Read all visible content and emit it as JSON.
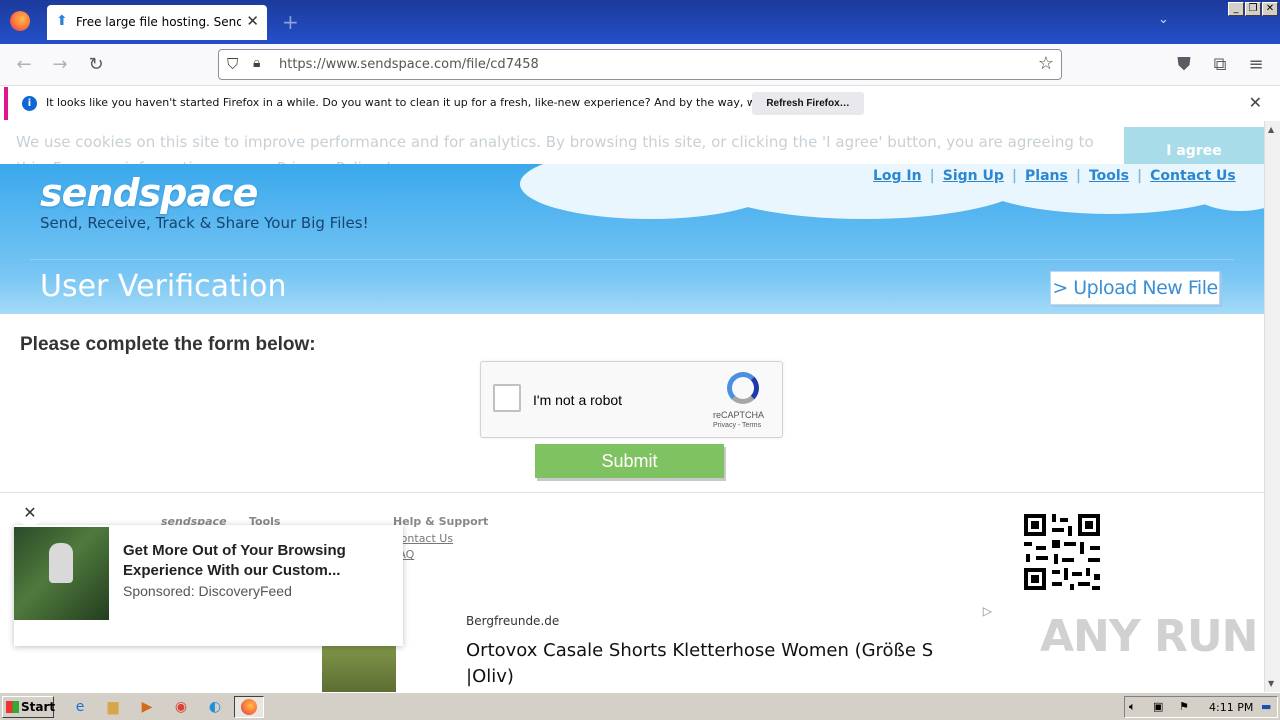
{
  "browser": {
    "tab_title": "Free large file hosting. Send big file",
    "url": "https://www.sendspace.com/file/cd7458",
    "notification": "It looks like you haven't started Firefox in a while. Do you want to clean it up for a fresh, like-new experience? And by the way, welcome back!",
    "refresh_label": "Refresh Firefox…"
  },
  "cookie": {
    "text": "We use cookies on this site to improve performance and for analytics. By browsing this site, or clicking the 'I agree' button, you are agreeing to this. For more information see our Privacy Policy.  Learn more",
    "agree_label": "I agree"
  },
  "header": {
    "logo": "sendspace",
    "tagline": "Send, Receive, Track & Share Your Big Files!",
    "links": [
      "Log In",
      "Sign Up",
      "Plans",
      "Tools",
      "Contact Us"
    ],
    "section_title": "User Verification",
    "upload_label": "> Upload New File"
  },
  "form": {
    "heading": "Please complete the form below:",
    "captcha_label": "I'm not a robot",
    "captcha_brand": "reCAPTCHA",
    "captcha_links": "Privacy - Terms",
    "submit_label": "Submit"
  },
  "footer": {
    "col1": "sendspace",
    "col2": "Tools",
    "col3": "Help & Support",
    "contact": "Contact Us",
    "faq": "FAQ"
  },
  "ads": {
    "ad1_headline": "Get More Out of Your Browsing Experience With our Custom...",
    "ad1_sponsor": "Sponsored: DiscoveryFeed",
    "ad2_source": "Bergfreunde.de",
    "ad2_title": "Ortovox Casale Shorts Kletterhose Women (Größe S |Oliv)"
  },
  "watermark": "ANY RUN",
  "taskbar": {
    "start_label": "Start",
    "clock": "4:11 PM"
  },
  "icons": {
    "back": "arrow-left-icon",
    "forward": "arrow-right-icon",
    "reload": "reload-icon",
    "shield": "shield-icon",
    "lock": "lock-icon",
    "bookmark": "star-icon",
    "pocket": "pocket-icon",
    "extensions": "puzzle-icon",
    "menu": "hamburger-icon"
  }
}
